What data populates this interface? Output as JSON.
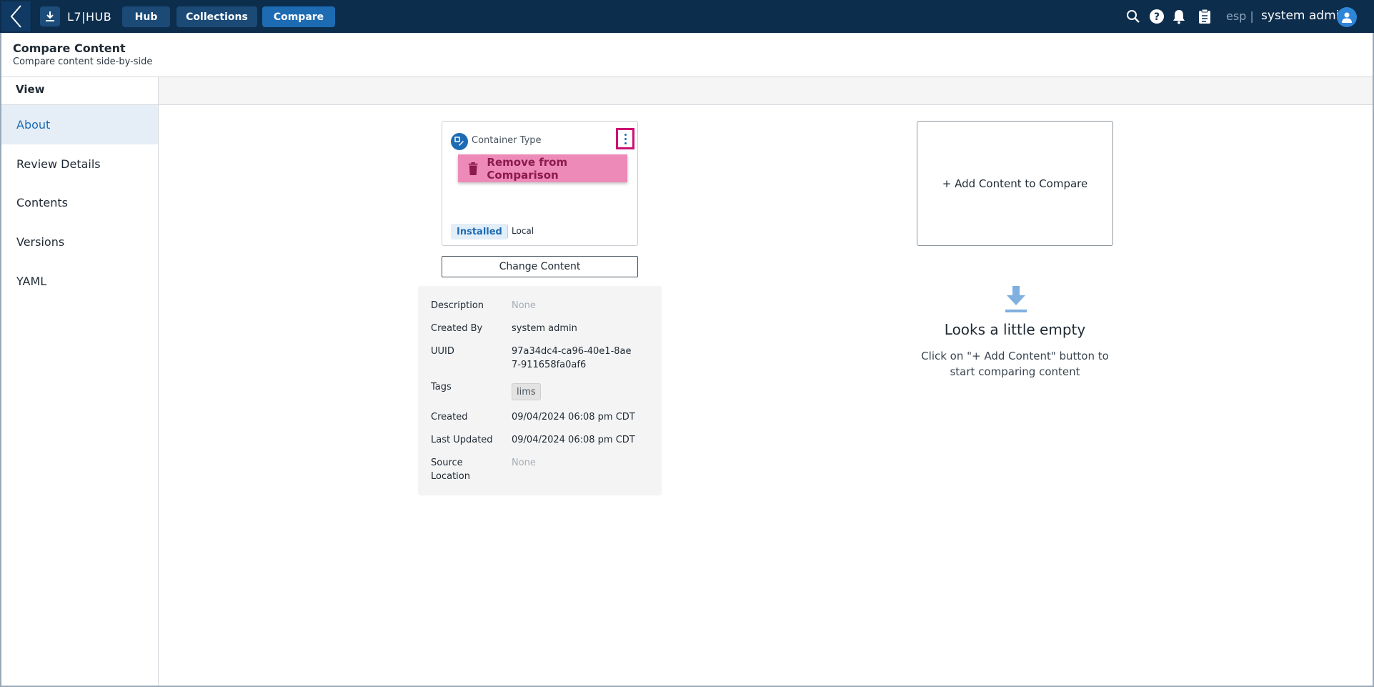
{
  "app": {
    "title": "L7|HUB",
    "nav": [
      {
        "label": "Hub"
      },
      {
        "label": "Collections"
      },
      {
        "label": "Compare"
      }
    ],
    "language": "esp |",
    "user": "system admin"
  },
  "page": {
    "title": "Compare Content",
    "subtitle": "Compare content side-by-side"
  },
  "sidebar": {
    "header": "View",
    "items": [
      {
        "label": "About"
      },
      {
        "label": "Review Details"
      },
      {
        "label": "Contents"
      },
      {
        "label": "Versions"
      },
      {
        "label": "YAML"
      }
    ]
  },
  "card": {
    "type_label": "Container Type",
    "menu_remove": "Remove from Comparison",
    "status": "Installed",
    "location": "Local",
    "change_button": "Change Content"
  },
  "details": {
    "description_label": "Description",
    "description_value": "None",
    "created_by_label": "Created By",
    "created_by_value": "system admin",
    "uuid_label": "UUID",
    "uuid_value": "97a34dc4-ca96-40e1-8ae7-911658fa0af6",
    "tags_label": "Tags",
    "tags_value": "lims",
    "created_label": "Created",
    "created_value": "09/04/2024 06:08 pm CDT",
    "last_updated_label": "Last Updated",
    "last_updated_value": "09/04/2024 06:08 pm CDT",
    "source_location_label": "Source Location",
    "source_location_value": "None"
  },
  "compare": {
    "add_label": "+ Add Content to Compare",
    "empty_title": "Looks a little empty",
    "empty_desc": "Click on \"+ Add Content\" button to start comparing content"
  },
  "colors": {
    "topbar": "#0d2d4d",
    "accent": "#1d6bb3",
    "highlight": "#cc1173",
    "remove_bg": "#ee8ab8"
  }
}
